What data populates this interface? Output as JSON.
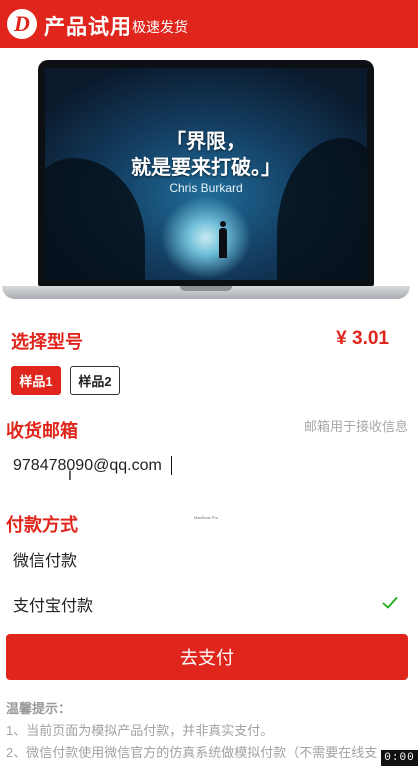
{
  "header": {
    "logo_letter": "D",
    "title": "产品试用",
    "subtitle": "极速发货"
  },
  "product": {
    "screen_quote_line1": "「界限，",
    "screen_quote_line2": "就是要来打破。」",
    "screen_author": "Chris Burkard",
    "laptop_brand": "MacBook Pro"
  },
  "model_section": {
    "title": "选择型号",
    "price": "¥ 3.01",
    "options": [
      "样品1",
      "样品2"
    ],
    "selected": "样品1"
  },
  "email_section": {
    "title": "收货邮箱",
    "hint": "邮箱用于接收信息",
    "value": "978478090@qq.com"
  },
  "payment_section": {
    "title": "付款方式",
    "options": [
      "微信付款",
      "支付宝付款"
    ],
    "selected": "支付宝付款"
  },
  "pay_button": "去支付",
  "tips": {
    "title": "温馨提示：",
    "lines": [
      "1、当前页面为模拟产品付款，并非真实支付。",
      "2、微信付款使用微信官方的仿真系统做模拟付款（不需要在线支"
    ]
  },
  "recording_timer": "0:00",
  "colors": {
    "accent": "#e0261c",
    "check": "#1aad19",
    "hint_text": "#a7a7a7"
  }
}
